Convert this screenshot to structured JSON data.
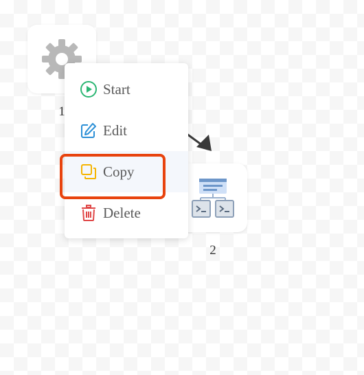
{
  "nodes": [
    {
      "label": "1",
      "icon": "gear-icon"
    },
    {
      "label": "2",
      "icon": "workflow-icon"
    }
  ],
  "context_menu": {
    "items": [
      {
        "label": "Start",
        "icon": "play-icon",
        "color": "#2bb673"
      },
      {
        "label": "Edit",
        "icon": "edit-icon",
        "color": "#2b8fd6"
      },
      {
        "label": "Copy",
        "icon": "copy-icon",
        "color": "#f5b400"
      },
      {
        "label": "Delete",
        "icon": "trash-icon",
        "color": "#e04848"
      }
    ]
  },
  "highlight": {
    "target": "Copy",
    "color": "#e8430e"
  }
}
